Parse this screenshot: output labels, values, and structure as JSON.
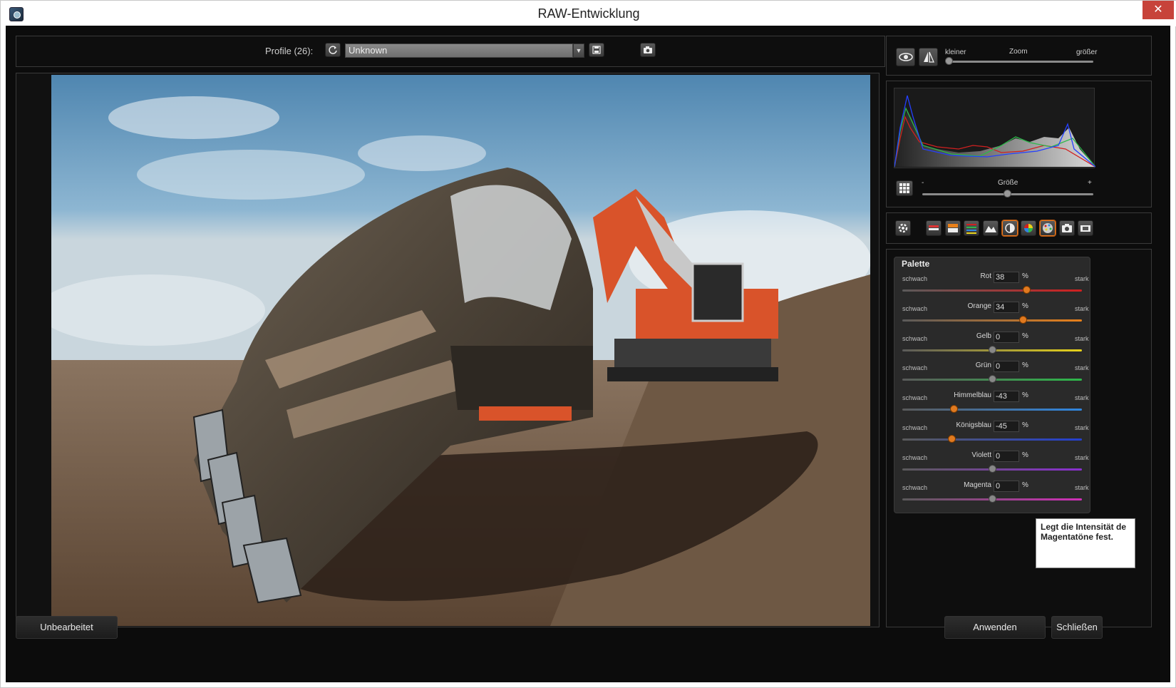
{
  "window": {
    "title": "RAW-Entwicklung",
    "close_glyph": "✕"
  },
  "toolbar": {
    "profile_label": "Profile (26):",
    "profile_value": "Unknown"
  },
  "zoom": {
    "smaller": "kleiner",
    "label": "Zoom",
    "bigger": "größer",
    "level": 0.0
  },
  "histogram": {
    "size_minus": "-",
    "size_label": "Größe",
    "size_plus": "+",
    "size_level": 0.48
  },
  "palette": {
    "title": "Palette",
    "weak_label": "schwach",
    "strong_label": "stark",
    "percent": "%",
    "rows": [
      {
        "name": "Rot",
        "value": "38",
        "color": "#d02020",
        "active": true
      },
      {
        "name": "Orange",
        "value": "34",
        "color": "#e8801a",
        "active": true
      },
      {
        "name": "Gelb",
        "value": "0",
        "color": "#e6d21a",
        "active": false
      },
      {
        "name": "Grün",
        "value": "0",
        "color": "#2db84a",
        "active": false
      },
      {
        "name": "Himmelblau",
        "value": "-43",
        "color": "#2f86e0",
        "active": true
      },
      {
        "name": "Königsblau",
        "value": "-45",
        "color": "#2440d0",
        "active": true
      },
      {
        "name": "Violett",
        "value": "0",
        "color": "#8a2fd0",
        "active": false
      },
      {
        "name": "Magenta",
        "value": "0",
        "color": "#d02fb8",
        "active": false
      }
    ]
  },
  "tooltip": {
    "line1": "Legt die Intensität de",
    "line2": "Magentatöne fest."
  },
  "buttons": {
    "original": "Unbearbeitet",
    "apply": "Anwenden",
    "close": "Schließen"
  },
  "colors": {
    "accent": "#e87a20",
    "panel_bg": "#0e0e0e",
    "border": "#3a3a3a"
  }
}
